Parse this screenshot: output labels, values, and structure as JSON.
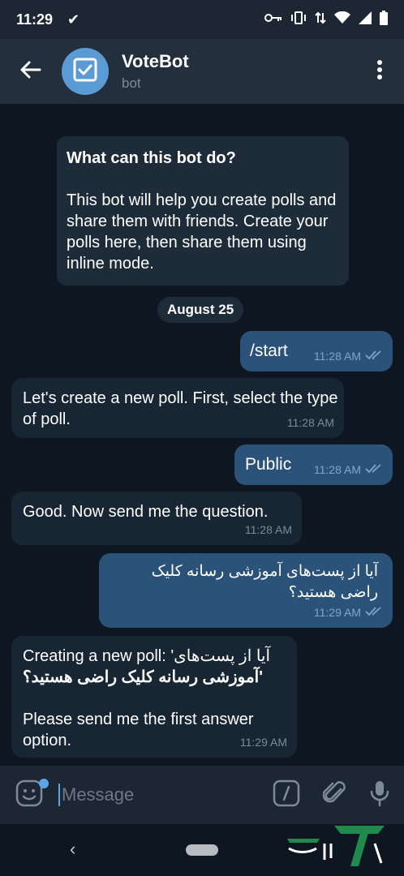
{
  "status_bar": {
    "time": "11:29"
  },
  "header": {
    "title": "VoteBot",
    "subtitle": "bot"
  },
  "intro": {
    "title": "What can this bot do?",
    "body": "This bot will help you create polls and share them with friends. Create your polls here, then share them using inline mode."
  },
  "date_separator": "August 25",
  "messages": [
    {
      "direction": "out",
      "text": "/start",
      "time": "11:28 AM"
    },
    {
      "direction": "in",
      "text": "Let's create a new poll. First, select the type of poll.",
      "time": "11:28 AM"
    },
    {
      "direction": "out",
      "text": "Public",
      "time": "11:28 AM"
    },
    {
      "direction": "in",
      "text": "Good. Now send me the question.",
      "time": "11:28 AM"
    },
    {
      "direction": "out",
      "text": "آیا از پست‌های آموزشی رسانه کلیک راضی هستید؟",
      "time": "11:29 AM"
    },
    {
      "direction": "in",
      "text_line1": "Creating a new poll: 'آیا از پست‌های",
      "text_line2": "'آموزشی رسانه کلیک راضی هستید؟",
      "text_line3": "Please send me the first answer option.",
      "time": "11:29 AM"
    }
  ],
  "input": {
    "placeholder": "Message"
  },
  "colors": {
    "accent": "#5aa7e8",
    "outgoing_bubble": "#2b5278",
    "incoming_bubble": "#182533",
    "chat_bg": "#0e1621",
    "header_bg": "#242f3d"
  }
}
